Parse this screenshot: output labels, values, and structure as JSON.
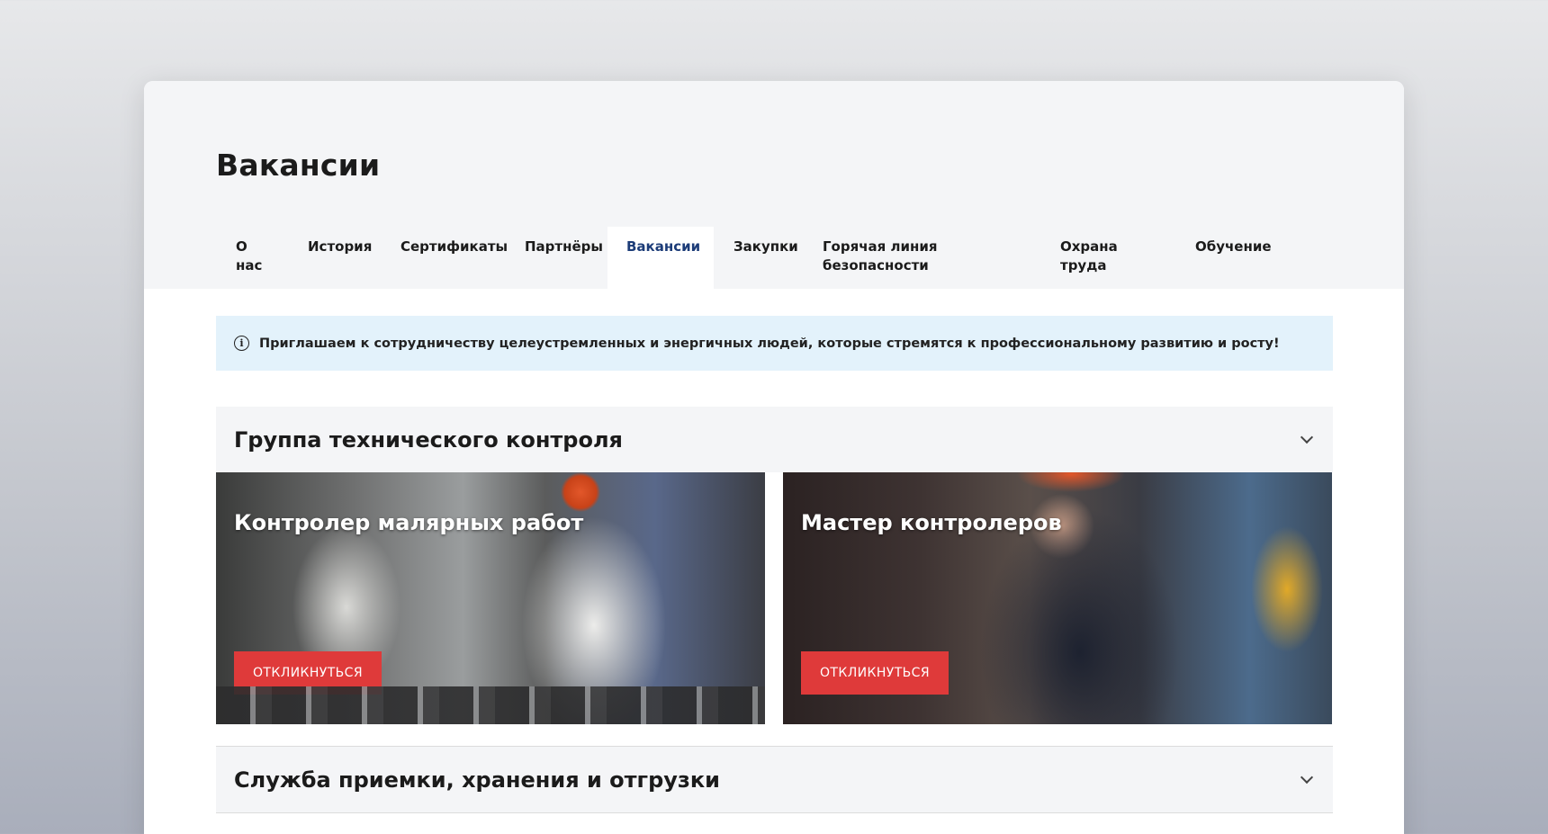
{
  "page": {
    "title": "Вакансии"
  },
  "tabs": [
    {
      "label": "О нас",
      "line1": "О",
      "line2": "нас"
    },
    {
      "label": "История"
    },
    {
      "label": "Сертификаты"
    },
    {
      "label": "Партнёры"
    },
    {
      "label": "Вакансии",
      "active": true
    },
    {
      "label": "Закупки"
    },
    {
      "label": "Горячая линия безопасности",
      "line1": "Горячая линия",
      "line2": "безопасности"
    },
    {
      "label": "Охрана труда",
      "line1": "Охрана",
      "line2": "труда"
    },
    {
      "label": "Обучение"
    }
  ],
  "info": {
    "icon": "info-icon",
    "text": "Приглашаем к сотрудничеству целеустремленных и энергичных людей, которые стремятся к профессиональному развитию и росту!"
  },
  "groups": [
    {
      "title": "Группа технического контроля",
      "expanded": true,
      "cards": [
        {
          "title": "Контролер малярных работ",
          "button": "Откликнуться"
        },
        {
          "title": "Мастер контролеров",
          "button": "Откликнуться"
        }
      ]
    },
    {
      "title": "Служба приемки, хранения и отгрузки",
      "expanded": false
    }
  ],
  "colors": {
    "accent": "#df3a3a",
    "active_tab": "#1c3c78",
    "info_bg": "#e3f2fb",
    "band_bg": "#f4f5f7"
  }
}
